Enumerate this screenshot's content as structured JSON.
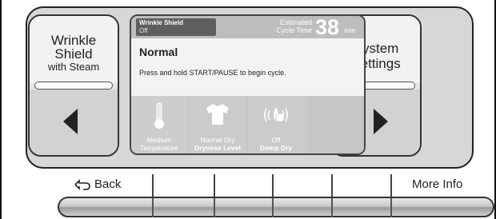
{
  "left_button": {
    "line1": "Wrinkle",
    "line2": "Shield",
    "line3": "with Steam"
  },
  "right_button": {
    "line1": "System",
    "line2": "Settings"
  },
  "screen": {
    "wrinkle_shield": {
      "title": "Wrinkle Shield",
      "value": "Off"
    },
    "estimated_label_1": "Estimated",
    "estimated_label_2": "Cycle Time",
    "time_value": "38",
    "time_unit": "min",
    "cycle_name": "Normal",
    "instruction": "Press and hold START/PAUSE to begin cycle.",
    "options": [
      {
        "icon": "thermometer-icon",
        "value": "Medium",
        "label": "Temperature"
      },
      {
        "icon": "shirt-icon",
        "value": "Normal Dry",
        "label": "Dryness Level"
      },
      {
        "icon": "damp-signal-icon",
        "value": "Off",
        "label": "Damp Dry"
      },
      {
        "icon": "",
        "value": "",
        "label": ""
      }
    ]
  },
  "softkeys": {
    "back_label": "Back",
    "more_label": "More Info"
  }
}
